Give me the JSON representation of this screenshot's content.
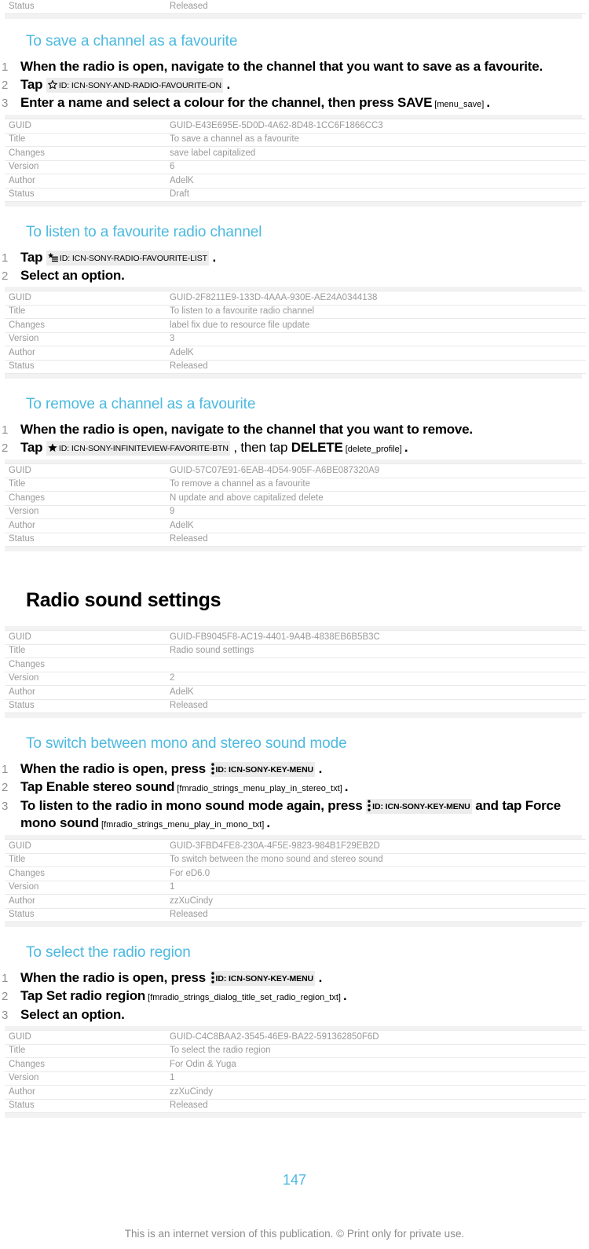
{
  "document": {
    "page_number": "147",
    "footnote": "This is an internet version of this publication. © Print only for private use.",
    "heading_color": "#4cb9e0",
    "meta_text_color": "#9a9a9a"
  },
  "meta_labels": {
    "guid": "GUID",
    "title": "Title",
    "changes": "Changes",
    "version": "Version",
    "author": "Author",
    "status": "Status"
  },
  "orphan_row": {
    "label": "Status",
    "value": "Released"
  },
  "sections": [
    {
      "heading": "To save a channel as a favourite",
      "steps": [
        {
          "num": "1",
          "parts": [
            {
              "type": "text",
              "text": "When the radio is open, navigate to the channel that you want to save as a favourite."
            }
          ]
        },
        {
          "num": "2",
          "parts": [
            {
              "type": "bold",
              "text": "Tap "
            },
            {
              "type": "icon",
              "icon": "star-outline-icon",
              "id": "ID: ICN-SONY-AND-RADIO-FAVOURITE-ON"
            },
            {
              "type": "bold",
              "text": " ."
            }
          ]
        },
        {
          "num": "3",
          "parts": [
            {
              "type": "text",
              "text": "Enter a name and select a colour for the channel, then press "
            },
            {
              "type": "bold",
              "text": "SAVE"
            },
            {
              "type": "ref",
              "text": " [menu_save] "
            },
            {
              "type": "bold",
              "text": "."
            }
          ]
        }
      ],
      "meta": {
        "guid": "GUID-E43E695E-5D0D-4A62-8D48-1CC6F1866CC3",
        "title": "To save a channel as a favourite",
        "changes": "save label capitalized",
        "version": "6",
        "author": "AdelK",
        "status": "Draft"
      }
    },
    {
      "heading": "To listen to a favourite radio channel",
      "steps": [
        {
          "num": "1",
          "parts": [
            {
              "type": "bold",
              "text": "Tap "
            },
            {
              "type": "icon",
              "icon": "favourite-list-icon",
              "id": "ID: ICN-SONY-RADIO-FAVOURITE-LIST"
            },
            {
              "type": "bold",
              "text": " ."
            }
          ]
        },
        {
          "num": "2",
          "parts": [
            {
              "type": "text",
              "text": "Select an option."
            }
          ]
        }
      ],
      "meta": {
        "guid": "GUID-2F8211E9-133D-4AAA-930E-AE24A0344138",
        "title": "To listen to a favourite radio channel",
        "changes": "label fix due to resource file update",
        "version": "3",
        "author": "AdelK",
        "status": "Released"
      }
    },
    {
      "heading": "To remove a channel as a favourite",
      "steps": [
        {
          "num": "1",
          "parts": [
            {
              "type": "text",
              "text": "When the radio is open, navigate to the channel that you want to remove."
            }
          ]
        },
        {
          "num": "2",
          "parts": [
            {
              "type": "bold",
              "text": "Tap "
            },
            {
              "type": "icon",
              "icon": "star-filled-icon",
              "id": "ID: ICN-SONY-INFINITEVIEW-FAVORITE-BTN"
            },
            {
              "type": "text",
              "text": " , then tap "
            },
            {
              "type": "bold",
              "text": "DELETE"
            },
            {
              "type": "ref",
              "text": " [delete_profile] "
            },
            {
              "type": "bold",
              "text": "."
            }
          ]
        }
      ],
      "meta": {
        "guid": "GUID-57C07E91-6EAB-4D54-905F-A6BE087320A9",
        "title": "To remove a channel as a favourite",
        "changes": "N update and above capitalized delete",
        "version": "9",
        "author": "AdelK",
        "status": "Released"
      }
    }
  ],
  "chapter": {
    "heading": "Radio sound settings",
    "meta": {
      "guid": "GUID-FB9045F8-AC19-4401-9A4B-4838EB6B5B3C",
      "title": "Radio sound settings",
      "changes": "",
      "version": "2",
      "author": "AdelK",
      "status": "Released"
    }
  },
  "sections2": [
    {
      "heading": "To switch between mono and stereo sound mode",
      "steps": [
        {
          "num": "1",
          "parts": [
            {
              "type": "text",
              "text": "When the radio is open, press "
            },
            {
              "type": "icon",
              "icon": "kebab-menu-icon",
              "id": "ID: ICN-SONY-KEY-MENU"
            },
            {
              "type": "bold",
              "text": " ."
            }
          ]
        },
        {
          "num": "2",
          "parts": [
            {
              "type": "text",
              "text": "Tap "
            },
            {
              "type": "bold",
              "text": "Enable stereo sound"
            },
            {
              "type": "ref",
              "text": " [fmradio_strings_menu_play_in_stereo_txt] "
            },
            {
              "type": "bold",
              "text": "."
            }
          ]
        },
        {
          "num": "3",
          "parts": [
            {
              "type": "text",
              "text": "To listen to the radio in mono sound mode again, press "
            },
            {
              "type": "icon",
              "icon": "kebab-menu-icon",
              "id": "ID: ICN-SONY-KEY-MENU"
            },
            {
              "type": "text",
              "text": "  and tap "
            },
            {
              "type": "bold",
              "text": "Force mono sound"
            },
            {
              "type": "ref",
              "text": " [fmradio_strings_menu_play_in_mono_txt] "
            },
            {
              "type": "bold",
              "text": "."
            }
          ]
        }
      ],
      "meta": {
        "guid": "GUID-3FBD4FE8-230A-4F5E-9823-984B1F29EB2D",
        "title": "To switch between the mono sound and stereo sound",
        "changes": "For eD6.0",
        "version": "1",
        "author": "zzXuCindy",
        "status": "Released"
      }
    },
    {
      "heading": "To select the radio region",
      "steps": [
        {
          "num": "1",
          "parts": [
            {
              "type": "text",
              "text": "When the radio is open, press "
            },
            {
              "type": "icon",
              "icon": "kebab-menu-icon",
              "id": "ID: ICN-SONY-KEY-MENU"
            },
            {
              "type": "bold",
              "text": " ."
            }
          ]
        },
        {
          "num": "2",
          "parts": [
            {
              "type": "text",
              "text": "Tap "
            },
            {
              "type": "bold",
              "text": "Set radio region"
            },
            {
              "type": "ref",
              "text": " [fmradio_strings_dialog_title_set_radio_region_txt] "
            },
            {
              "type": "bold",
              "text": "."
            }
          ]
        },
        {
          "num": "3",
          "parts": [
            {
              "type": "text",
              "text": "Select an option."
            }
          ]
        }
      ],
      "meta": {
        "guid": "GUID-C4C8BAA2-3545-46E9-BA22-591362850F6D",
        "title": "To select the radio region",
        "changes": "For Odin & Yuga",
        "version": "1",
        "author": "zzXuCindy",
        "status": "Released"
      }
    }
  ]
}
